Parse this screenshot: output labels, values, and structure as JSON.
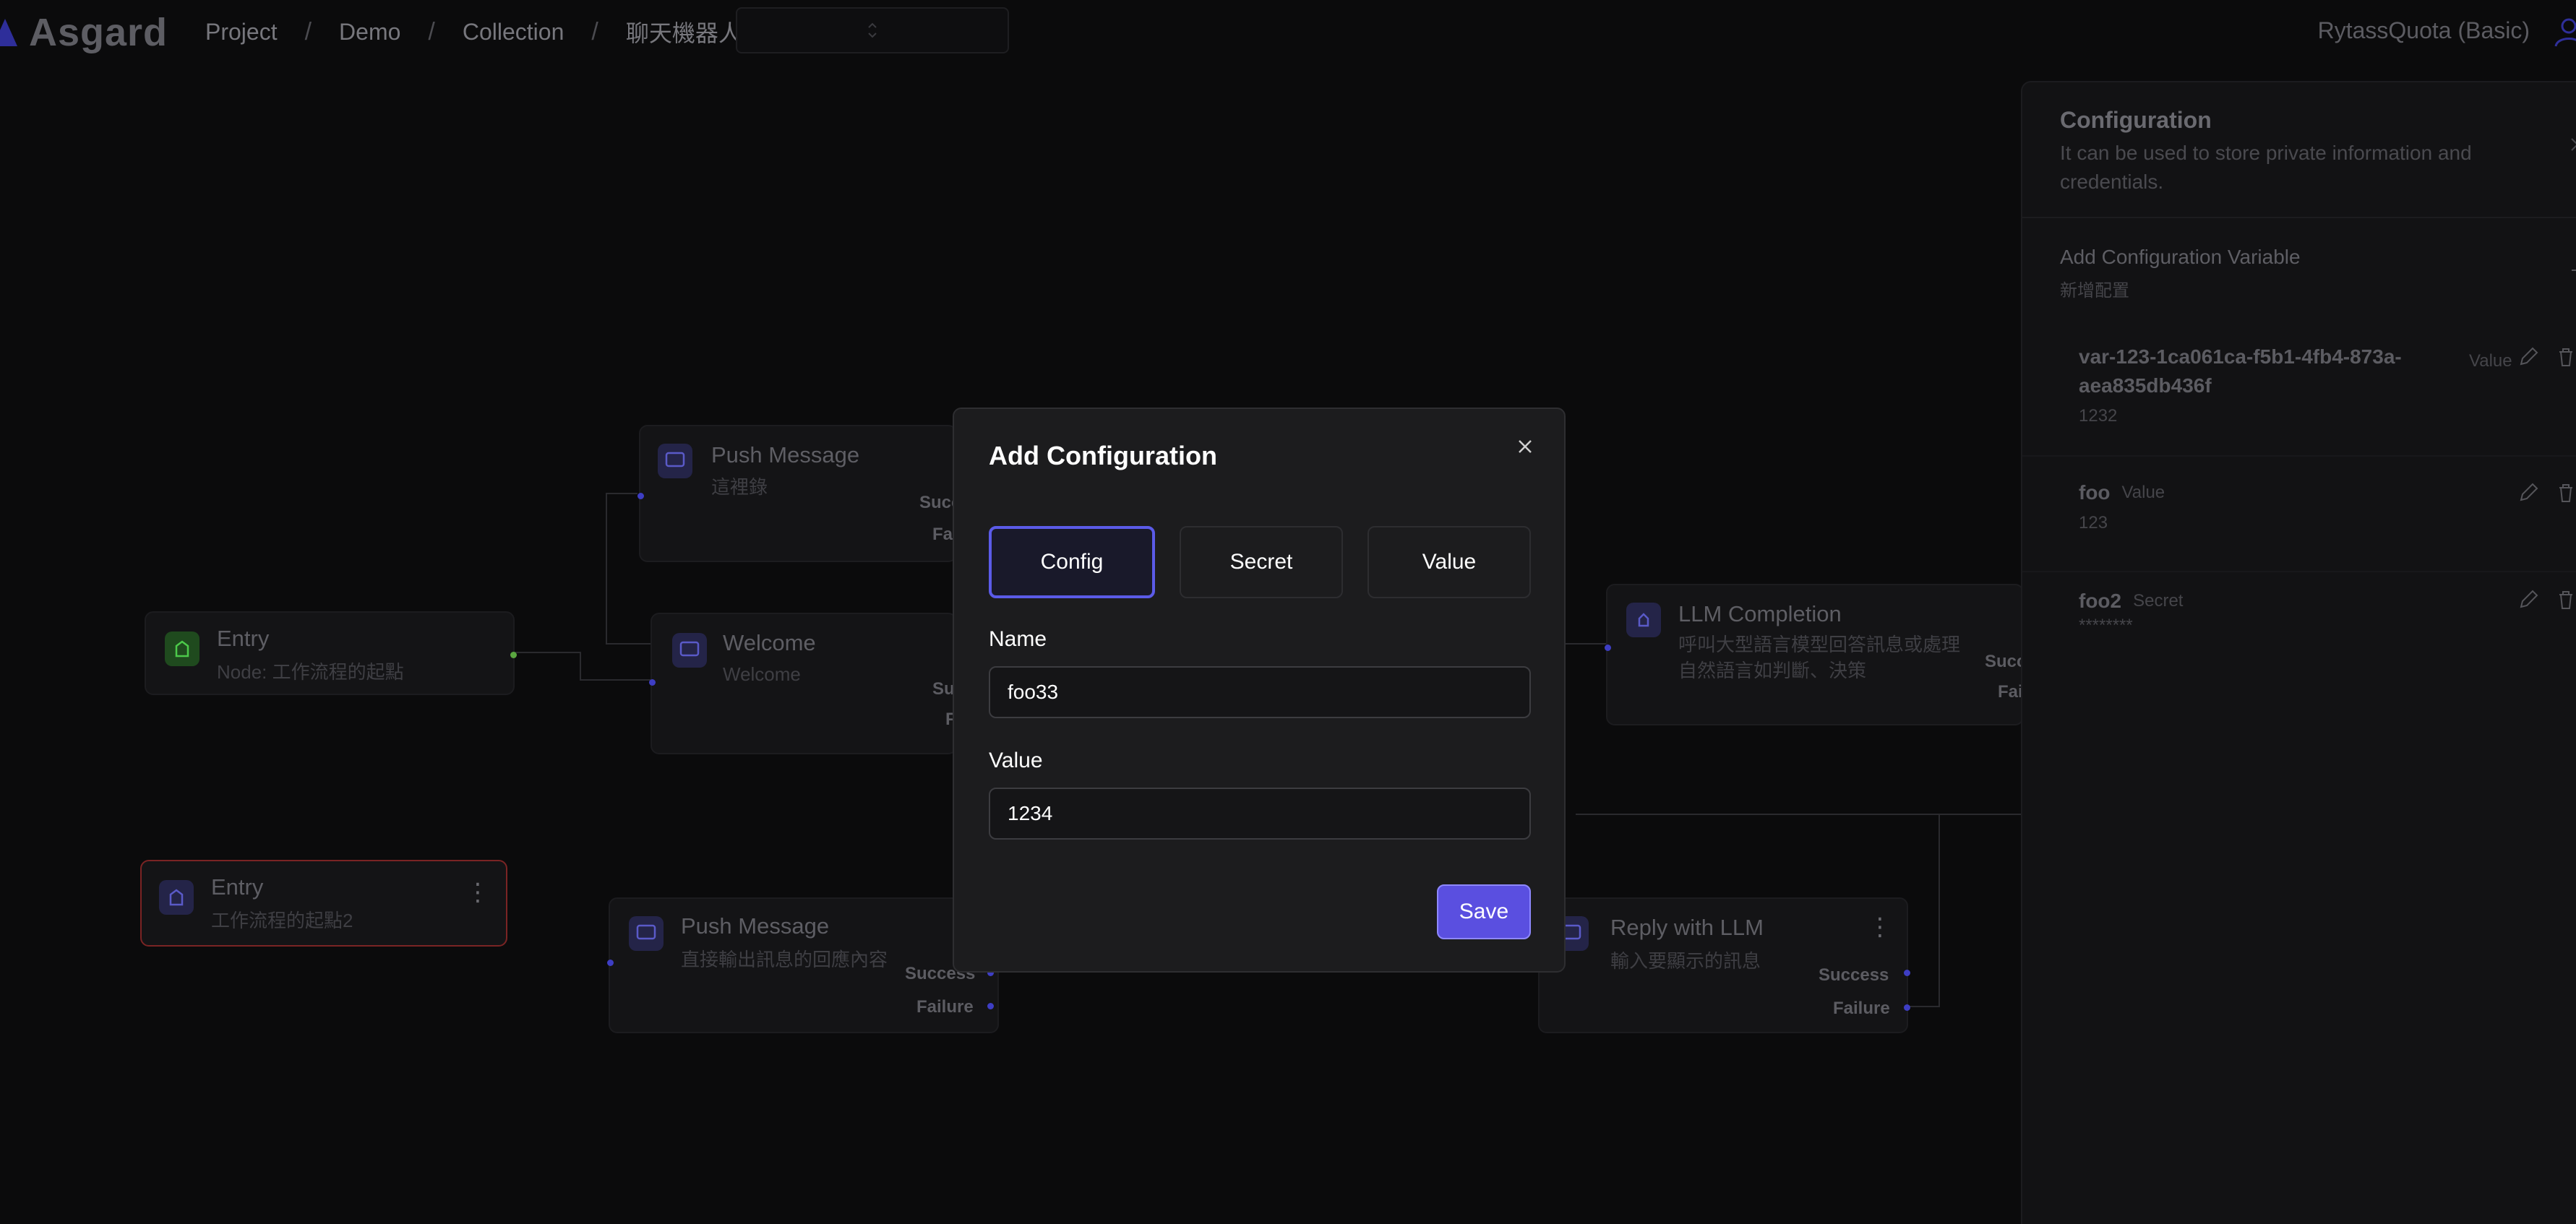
{
  "header": {
    "logo": "Asgard",
    "breadcrumbs": [
      "Project",
      "Demo",
      "Collection",
      "聊天機器人"
    ],
    "version_select": "",
    "quota": "RytassQuota (Basic)"
  },
  "nodes": {
    "push1": {
      "title": "Push Message",
      "subtitle": "這裡錄",
      "success": "Succ",
      "failure": "Fai"
    },
    "entry1": {
      "title": "Entry",
      "subtitle": "Node: 工作流程的起點"
    },
    "welcome": {
      "title": "Welcome",
      "subtitle": "Welcome",
      "success": "Su",
      "failure": "F"
    },
    "llm": {
      "title": "LLM Completion",
      "subtitle": "呼叫大型語言模型回答訊息或處理自然語言如判斷、決策",
      "success": "Succ",
      "failure": "Fai"
    },
    "entry2": {
      "title": "Entry",
      "subtitle": "工作流程的起點2"
    },
    "push2": {
      "title": "Push Message",
      "subtitle": "直接輸出訊息的回應內容",
      "success": "Success",
      "failure": "Failure"
    },
    "reply": {
      "title": "Reply with LLM",
      "subtitle": "輸入要顯示的訊息",
      "success": "Success",
      "failure": "Failure"
    }
  },
  "panel": {
    "title": "Configuration",
    "description": "It can be used to store private information and credentials.",
    "add_title": "Add Configuration Variable",
    "add_subtitle": "新增配置",
    "variables": [
      {
        "name": "var-123-1ca061ca-f5b1-4fb4-873a-aea835db436f",
        "type": "Value",
        "value": "1232"
      },
      {
        "name": "foo",
        "type": "Value",
        "value": "123"
      },
      {
        "name": "foo2",
        "type": "Secret",
        "value": "********"
      }
    ]
  },
  "modal": {
    "title": "Add Configuration",
    "tabs": [
      "Config",
      "Secret",
      "Value"
    ],
    "active_tab": "Config",
    "name_label": "Name",
    "name_value": "foo33",
    "value_label": "Value",
    "value_value": "1234",
    "save_label": "Save"
  },
  "colors": {
    "accent": "#5a4fe0",
    "background": "#0b0b0c",
    "modal_bg": "#1c1c1e"
  }
}
